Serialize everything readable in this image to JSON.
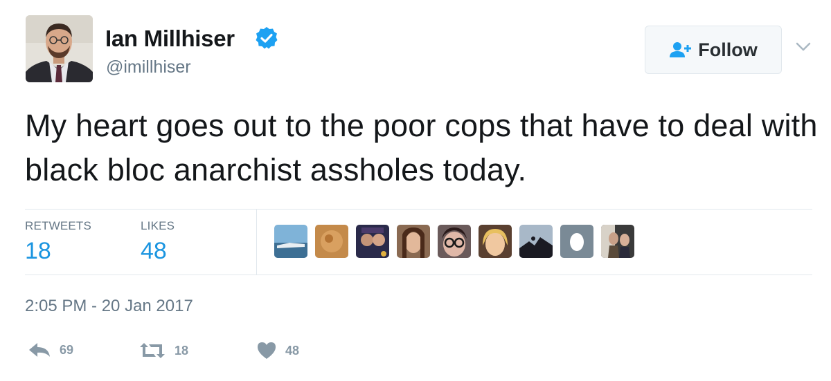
{
  "author": {
    "name": "Ian Millhiser",
    "handle": "@imillhiser",
    "verified": true
  },
  "follow_button": {
    "label": "Follow",
    "icon": "add-user-icon"
  },
  "tweet": {
    "text": "My heart goes out to the poor cops that have to deal with black bloc anarchist assholes today."
  },
  "stats": {
    "retweets_label": "RETWEETS",
    "retweets_value": "18",
    "likes_label": "LIKES",
    "likes_value": "48"
  },
  "timestamp": "2:05 PM - 20 Jan 2017",
  "actions": {
    "reply_count": "69",
    "retweet_count": "18",
    "like_count": "48"
  },
  "colors": {
    "link_blue": "#1b95e0",
    "verified_blue": "#1da1f2",
    "secondary_gray": "#657786",
    "action_gray": "#8899a6"
  }
}
